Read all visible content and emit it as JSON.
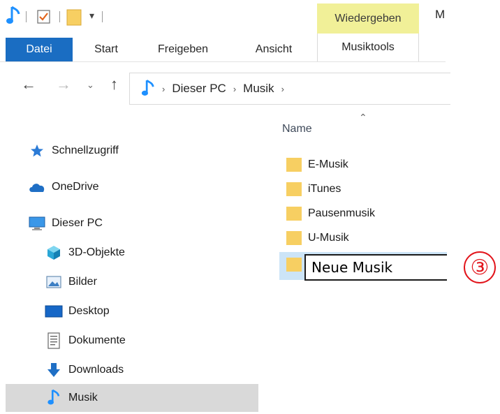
{
  "quick_access": {
    "icons": [
      "music-note-icon",
      "properties-check-icon",
      "new-folder-icon",
      "customize-dropdown-icon"
    ]
  },
  "ribbon": {
    "context_tab": "Wiedergeben",
    "context_subtab": "Musiktools",
    "title_truncated": "M",
    "tabs": [
      "Datei",
      "Start",
      "Freigeben",
      "Ansicht"
    ]
  },
  "address_bar": {
    "crumbs": [
      "Dieser PC",
      "Musik"
    ]
  },
  "nav_pane": {
    "items": [
      {
        "label": "Schnellzugriff",
        "icon": "star-icon"
      },
      {
        "label": "OneDrive",
        "icon": "cloud-icon"
      },
      {
        "label": "Dieser PC",
        "icon": "monitor-icon"
      },
      {
        "label": "3D-Objekte",
        "icon": "cube-icon"
      },
      {
        "label": "Bilder",
        "icon": "pictures-icon"
      },
      {
        "label": "Desktop",
        "icon": "desktop-icon"
      },
      {
        "label": "Dokumente",
        "icon": "document-icon"
      },
      {
        "label": "Downloads",
        "icon": "download-arrow-icon"
      },
      {
        "label": "Musik",
        "icon": "music-note-icon"
      }
    ],
    "selected": "Musik"
  },
  "content": {
    "column_name": "Name",
    "folders": [
      "E-Musik",
      "iTunes",
      "Pausenmusik",
      "U-Musik"
    ],
    "rename_value": "Neue Musik"
  },
  "annotation": {
    "step": "③"
  },
  "colors": {
    "accent": "#1a6dc2",
    "context_tab": "#f1f098",
    "folder": "#f7cf62",
    "selection": "#cce4f7",
    "badge": "#e2141b"
  }
}
